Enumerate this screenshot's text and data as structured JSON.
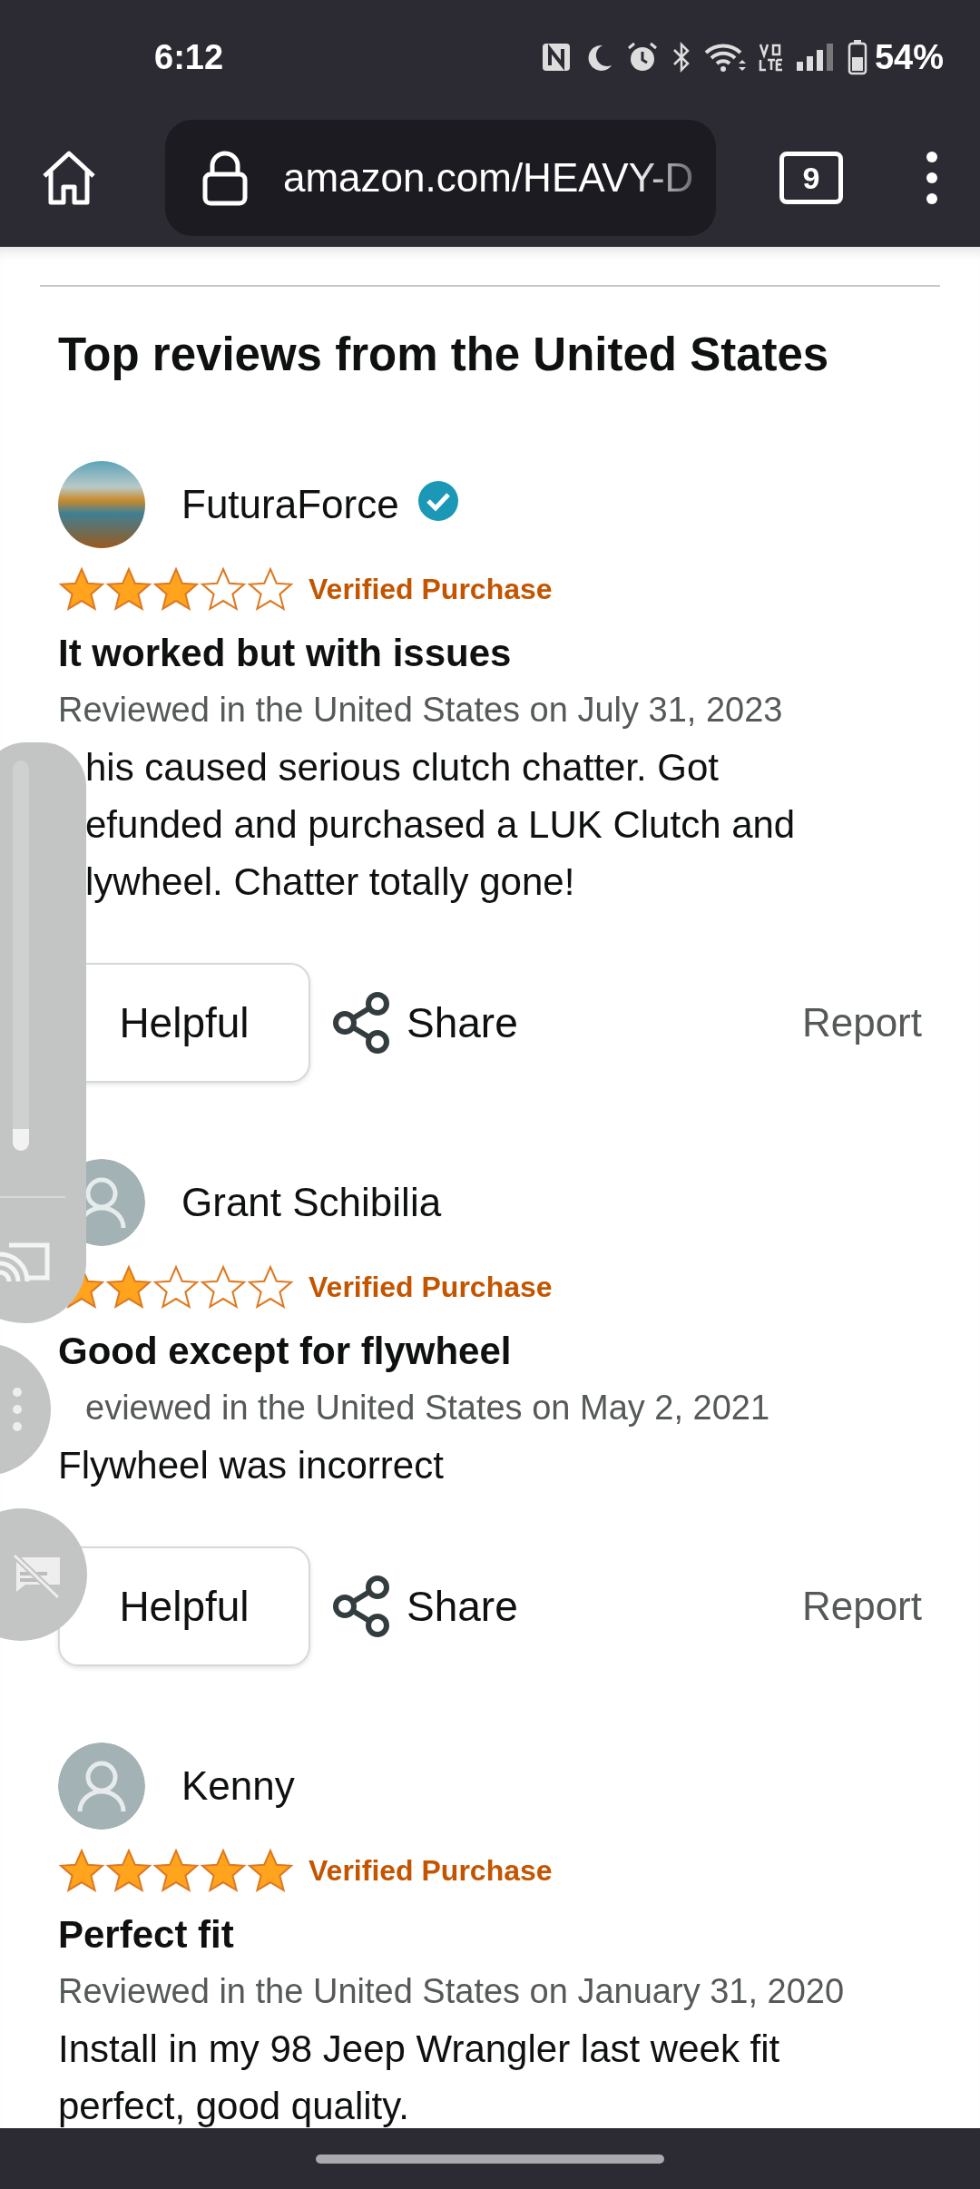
{
  "status_bar": {
    "time": "6:12",
    "battery": "54%"
  },
  "browser": {
    "url": "amazon.com/HEAVY-D",
    "tab_count": "9"
  },
  "section_title": "Top reviews from the United States",
  "reviews": [
    {
      "reviewer": "FuturaForce",
      "avatar": {
        "kind": "photo"
      },
      "verified_badge": true,
      "stars": 3,
      "verified": "Verified Purchase",
      "title": "It worked but with issues",
      "date": "Reviewed in the United States on July 31, 2023",
      "date_under_panel": false,
      "body_lines": [
        {
          "text": "his caused serious clutch chatter. Got",
          "under_panel": true
        },
        {
          "text": "efunded and purchased a LUK Clutch and",
          "under_panel": true
        },
        {
          "text": "lywheel. Chatter totally gone!",
          "under_panel": true
        }
      ],
      "actions": {
        "helpful": "Helpful",
        "share": "Share",
        "report": "Report"
      }
    },
    {
      "reviewer": "Grant Schibilia",
      "avatar": {
        "kind": "default"
      },
      "verified_badge": false,
      "stars": 2,
      "verified": "Verified Purchase",
      "title": "Good except for flywheel",
      "date": "eviewed in the United States on May 2, 2021",
      "date_under_panel": true,
      "body_lines": [
        {
          "text": "Flywheel was incorrect",
          "under_panel": false
        }
      ],
      "actions": {
        "helpful": "Helpful",
        "share": "Share",
        "report": "Report"
      }
    },
    {
      "reviewer": "Kenny",
      "avatar": {
        "kind": "default"
      },
      "verified_badge": false,
      "stars": 5,
      "verified": "Verified Purchase",
      "title": "Perfect fit",
      "date": "Reviewed in the United States on January 31, 2020",
      "date_under_panel": false,
      "body_lines": [
        {
          "text": "Install in my 98 Jeep Wrangler last week fit",
          "under_panel": false
        },
        {
          "text": "perfect, good quality.",
          "under_panel": false
        }
      ]
    }
  ]
}
